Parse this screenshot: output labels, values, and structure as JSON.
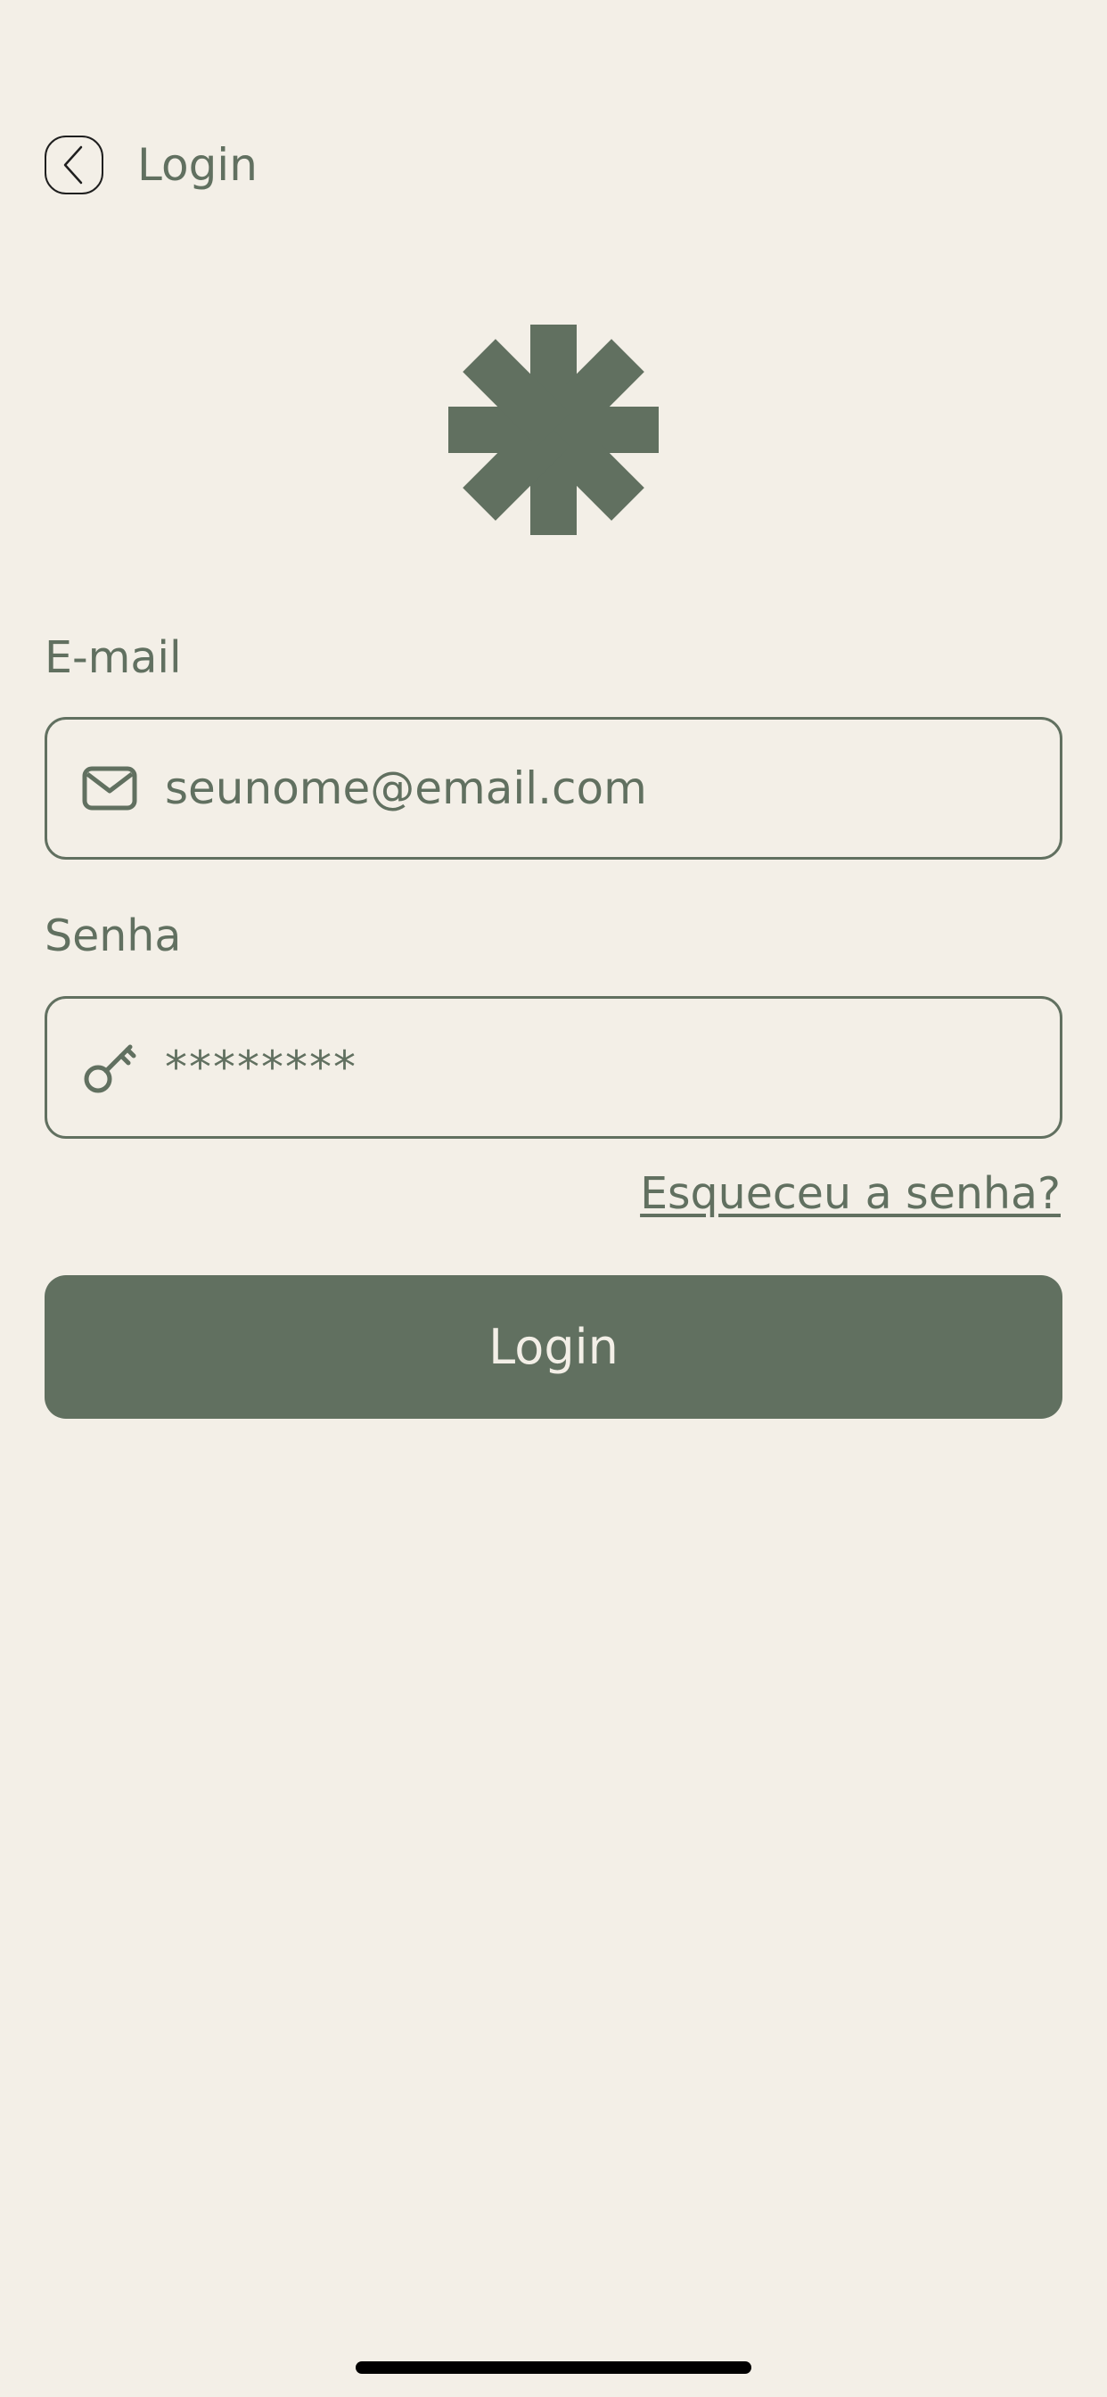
{
  "header": {
    "back_icon": "chevron-left-icon",
    "title": "Login"
  },
  "logo": {
    "icon": "asterisk-logo-icon"
  },
  "email": {
    "label": "E-mail",
    "icon": "mail-icon",
    "value": "seunome@email.com"
  },
  "password": {
    "label": "Senha",
    "icon": "key-icon",
    "value": "********"
  },
  "forgot_password": "Esqueceu a senha?",
  "login_button": "Login",
  "colors": {
    "background": "#F3EFE7",
    "accent": "#617060",
    "button_text": "#F3EFE7"
  }
}
